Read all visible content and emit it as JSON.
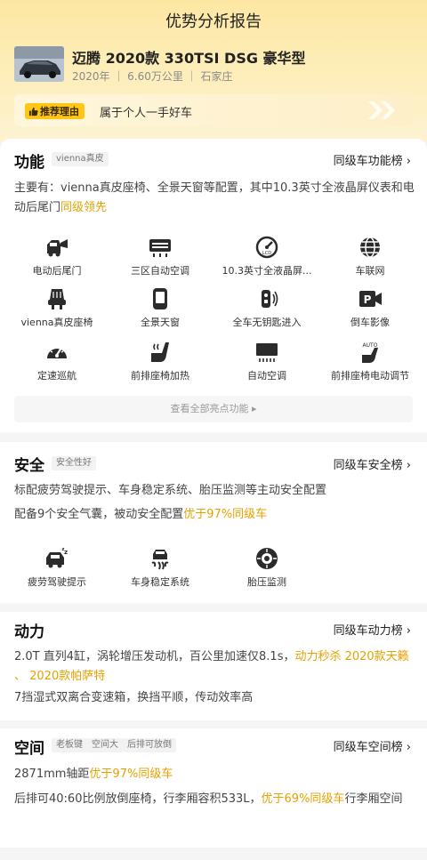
{
  "header": {
    "title": "优势分析报告",
    "car_name": "迈腾 2020款 330TSI DSG 豪华型",
    "car_meta": "2020年 ｜ 6.60万公里 ｜ 石家庄",
    "reason_tag": "推荐理由",
    "reason_text": "属于个人一手好车"
  },
  "function": {
    "title": "功能",
    "tag": "vienna真皮",
    "rank_link": "同级车功能榜 ›",
    "desc_main": "主要有：vienna真皮座椅、全景天窗等配置，其中10.3英寸全液晶屏仪表和电动后尾门",
    "desc_highlight": "同级领先",
    "features": [
      {
        "label": "电动后尾门",
        "icon": "power-tailgate-icon"
      },
      {
        "label": "三区自动空调",
        "icon": "tri-zone-ac-icon"
      },
      {
        "label": "10.3英寸全液晶屏...",
        "icon": "lcd-dashboard-icon"
      },
      {
        "label": "车联网",
        "icon": "connected-car-icon"
      },
      {
        "label": "vienna真皮座椅",
        "icon": "leather-seat-icon"
      },
      {
        "label": "全景天窗",
        "icon": "panoramic-sunroof-icon"
      },
      {
        "label": "全车无钥匙进入",
        "icon": "keyless-entry-icon"
      },
      {
        "label": "倒车影像",
        "icon": "reverse-camera-icon"
      },
      {
        "label": "定速巡航",
        "icon": "cruise-control-icon"
      },
      {
        "label": "前排座椅加热",
        "icon": "seat-heating-icon"
      },
      {
        "label": "自动空调",
        "icon": "auto-ac-icon"
      },
      {
        "label": "前排座椅电动调节",
        "icon": "power-seat-icon"
      }
    ],
    "more_label": "查看全部亮点功能 ▸"
  },
  "safety": {
    "title": "安全",
    "tag": "安全性好",
    "rank_link": "同级车安全榜 ›",
    "line1": "标配疲劳驾驶提示、车身稳定系统、胎压监测等主动安全配置",
    "line2_main": "配备9个安全气囊，被动安全配置",
    "line2_highlight": "优于97%同级车",
    "features": [
      {
        "label": "疲劳驾驶提示",
        "icon": "fatigue-alert-icon"
      },
      {
        "label": "车身稳定系统",
        "icon": "stability-control-icon"
      },
      {
        "label": "胎压监测",
        "icon": "tire-pressure-icon"
      }
    ]
  },
  "power": {
    "title": "动力",
    "rank_link": "同级车动力榜 ›",
    "line1_main": "2.0T 直列4缸，涡轮增压发动机，百公里加速仅8.1s，",
    "line1_highlight": "动力秒杀 2020款天籁 、 2020款帕萨特",
    "line2": "7挡湿式双离合变速箱，换挡平顺，传动效率高"
  },
  "space": {
    "title": "空间",
    "tags": [
      "老板键",
      "空间大",
      "后排可放倒"
    ],
    "rank_link": "同级车空间榜 ›",
    "line1_main": "2871mm轴距",
    "line1_highlight": "优于97%同级车",
    "line2_main": "后排可40:60比例放倒座椅，行李厢容积533L，",
    "line2_highlight": "优于69%同级车",
    "line2_tail": "行李厢空间"
  },
  "colors": {
    "accent": "#ffc617",
    "highlight": "#e6a100",
    "icon": "#2b2b2b",
    "header_bg": "#fde7a3"
  }
}
